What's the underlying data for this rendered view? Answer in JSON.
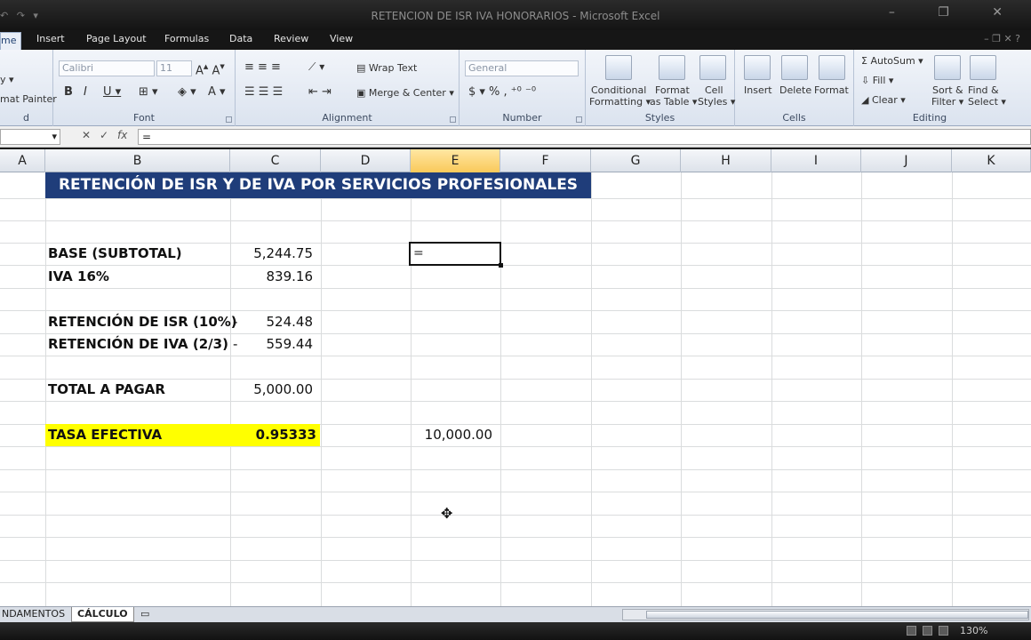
{
  "window": {
    "title": "RETENCION DE ISR IVA HONORARIOS - Microsoft Excel"
  },
  "tabs": [
    "me",
    "Insert",
    "Page Layout",
    "Formulas",
    "Data",
    "Review",
    "View"
  ],
  "ribbon": {
    "clipboard": {
      "copy": "y ▾",
      "painter": "mat Painter",
      "label": "d"
    },
    "font": {
      "name": "Calibri",
      "size": "11",
      "label": "Font"
    },
    "alignment": {
      "wrap": "Wrap Text",
      "merge": "Merge & Center ▾",
      "label": "Alignment"
    },
    "number": {
      "format": "General",
      "label": "Number"
    },
    "styles": {
      "conditional": "Conditional",
      "conditional2": "Formatting ▾",
      "astable": "Format",
      "astable2": "as Table ▾",
      "cell": "Cell",
      "cell2": "Styles ▾",
      "label": "Styles"
    },
    "cells": {
      "insert": "Insert",
      "delete": "Delete",
      "format": "Format",
      "label": "Cells"
    },
    "editing": {
      "autosum": "AutoSum ▾",
      "fill": "Fill ▾",
      "clear": "Clear ▾",
      "sort": "Sort &",
      "sort2": "Filter ▾",
      "find": "Find &",
      "find2": "Select ▾",
      "label": "Editing"
    }
  },
  "formula_bar": {
    "name_box": "",
    "fx": "fx",
    "value": "="
  },
  "columns": [
    "A",
    "B",
    "C",
    "D",
    "E",
    "F",
    "G",
    "H",
    "I",
    "J",
    "K"
  ],
  "selected_column": "E",
  "sheet": {
    "banner": "RETENCIÓN DE ISR Y DE IVA POR SERVICIOS PROFESIONALES",
    "rows": [
      {
        "label": "BASE (SUBTOTAL)",
        "sign": "",
        "value": "5,244.75"
      },
      {
        "label": "IVA 16%",
        "sign": "",
        "value": "839.16"
      },
      {
        "label": "RETENCIÓN DE ISR (10%)",
        "sign": "-",
        "value": "524.48"
      },
      {
        "label": "RETENCIÓN DE IVA (2/3)",
        "sign": "-",
        "value": "559.44"
      },
      {
        "label": "TOTAL A PAGAR",
        "sign": "",
        "value": "5,000.00"
      },
      {
        "label": "TASA EFECTIVA",
        "sign": "",
        "value": "0.95333"
      }
    ],
    "active_cell_content": "=",
    "e_value": "10,000.00"
  },
  "sheet_tabs": [
    "NDAMENTOS",
    "CÁLCULO"
  ],
  "status": {
    "zoom": "130%"
  },
  "colors": {
    "banner": "#1f3d7a",
    "highlight": "#ffff00",
    "accent": "#f9c95a"
  }
}
